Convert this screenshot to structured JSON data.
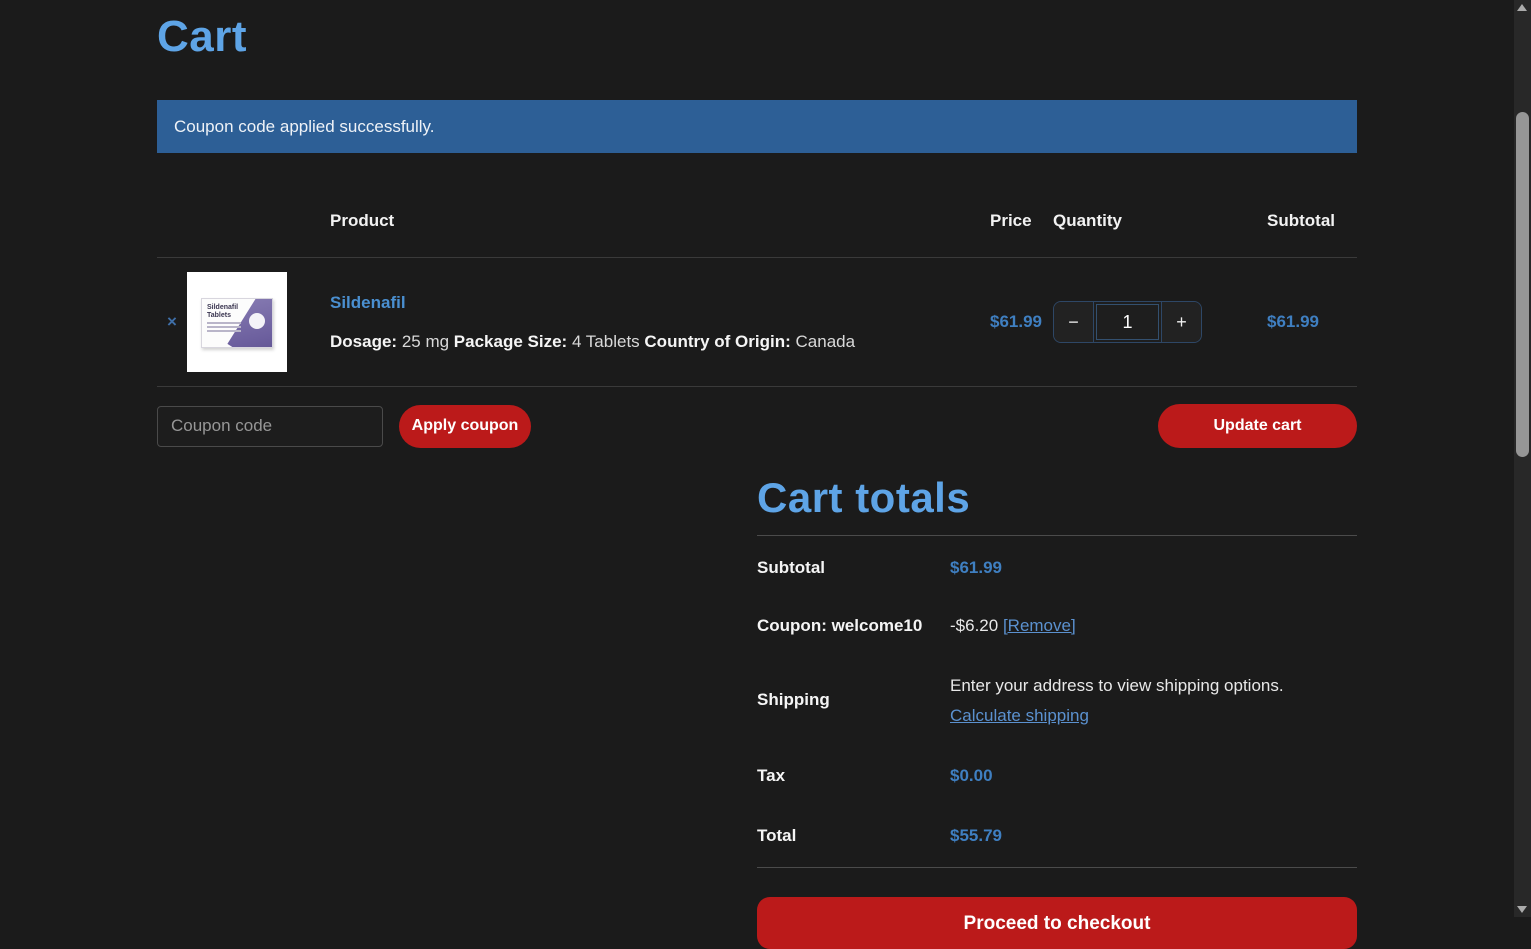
{
  "page": {
    "title": "Cart",
    "notice": "Coupon code applied successfully."
  },
  "table": {
    "headers": {
      "product": "Product",
      "price": "Price",
      "quantity": "Quantity",
      "subtotal": "Subtotal"
    },
    "items": [
      {
        "remove_label": "×",
        "name": "Sildenafil",
        "image_text": "Sildenafil Tablets",
        "attributes": [
          {
            "label": "Dosage:",
            "value": "25 mg"
          },
          {
            "label": "Package Size:",
            "value": "4 Tablets"
          },
          {
            "label": "Country of Origin:",
            "value": "Canada"
          }
        ],
        "price": "$61.99",
        "quantity": "1",
        "minus_label": "−",
        "plus_label": "+",
        "subtotal": "$61.99"
      }
    ]
  },
  "coupon": {
    "placeholder": "Coupon code",
    "apply_label": "Apply coupon",
    "update_cart_label": "Update cart"
  },
  "totals": {
    "title": "Cart totals",
    "subtotal_label": "Subtotal",
    "subtotal_value": "$61.99",
    "coupon_label": "Coupon: welcome10",
    "coupon_value": "-$6.20",
    "coupon_remove_label": "[Remove]",
    "shipping_label": "Shipping",
    "shipping_text": "Enter your address to view shipping options.",
    "shipping_link_label": "Calculate shipping",
    "tax_label": "Tax",
    "tax_value": "$0.00",
    "total_label": "Total",
    "total_value": "$55.79",
    "checkout_label": "Proceed to checkout"
  },
  "colors": {
    "background": "#1b1b1b",
    "heading_blue": "#5ea4e6",
    "link_blue": "#4a8fd0",
    "price_blue": "#3f7fc1",
    "banner_blue": "#2d5f96",
    "button_red": "#bb1a1a",
    "divider_gray": "#3a3a3a"
  }
}
